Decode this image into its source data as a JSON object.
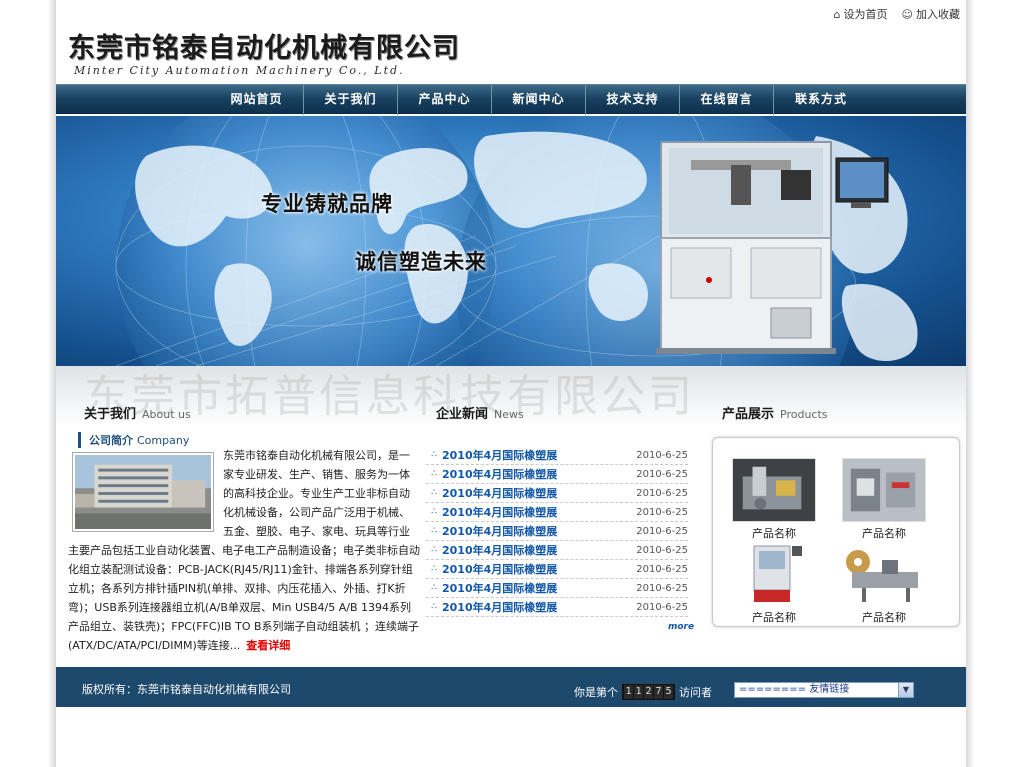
{
  "header": {
    "logo_cn": "东莞市铭泰自动化机械有限公司",
    "logo_en": "Minter City Automation Machinery Co., Ltd.",
    "set_home": "设为首页",
    "add_favorite": "加入收藏"
  },
  "nav": {
    "items": [
      "网站首页",
      "关于我们",
      "产品中心",
      "新闻中心",
      "技术支持",
      "在线留言",
      "联系方式"
    ]
  },
  "banner": {
    "line1": "专业铸就品牌",
    "line2": "诚信塑造未来",
    "watermark": "东莞市拓普信息科技有限公司"
  },
  "about": {
    "title": "关于我们",
    "title_en": "About us",
    "company_label": "公司简介",
    "company_label_en": "Company",
    "intro": "东莞市铭泰自动化机械有限公司，是一家专业研发、生产、销售、服务为一体的高科技企业。专业生产工业非标自动化机械设备，公司产品广泛用于机械、五金、塑胶、电子、家电、玩具等行业主要产品包括工业自动化装置、电子电工产品制造设备；电子类非标自动化组立装配测试设备：PCB-JACK(RJ45/RJ11)金针、排端各系列穿针组立机；各系列方排针插PIN机(单排、双排、内压花插入、外插、打K折弯)；USB系列连接器组立机(A/B单双层、Min USB4/5 A/B 1394系列产品组立、装铁壳)；FPC(FFC)IB TO B系列端子自动组装机 ；连续端子(ATX/DC/ATA/PCI/DIMM)等连接...",
    "more_label": "查看详细"
  },
  "news": {
    "title": "企业新闻",
    "title_en": "News",
    "items": [
      {
        "title": "2010年4月国际橡塑展",
        "date": "2010-6-25"
      },
      {
        "title": "2010年4月国际橡塑展",
        "date": "2010-6-25"
      },
      {
        "title": "2010年4月国际橡塑展",
        "date": "2010-6-25"
      },
      {
        "title": "2010年4月国际橡塑展",
        "date": "2010-6-25"
      },
      {
        "title": "2010年4月国际橡塑展",
        "date": "2010-6-25"
      },
      {
        "title": "2010年4月国际橡塑展",
        "date": "2010-6-25"
      },
      {
        "title": "2010年4月国际橡塑展",
        "date": "2010-6-25"
      },
      {
        "title": "2010年4月国际橡塑展",
        "date": "2010-6-25"
      },
      {
        "title": "2010年4月国际橡塑展",
        "date": "2010-6-25"
      }
    ],
    "more_label": "more"
  },
  "products": {
    "title": "产品展示",
    "title_en": "Products",
    "items": [
      {
        "name": "产品名称",
        "icon": "machine-photo"
      },
      {
        "name": "产品名称",
        "icon": "machine-photo"
      },
      {
        "name": "产品名称",
        "icon": "machine-photo"
      },
      {
        "name": "产品名称",
        "icon": "machine-photo"
      }
    ]
  },
  "footer": {
    "copyright": "版权所有：东莞市铭泰自动化机械有限公司",
    "visit_prefix": "你是第个",
    "counter_digits": [
      "1",
      "1",
      "2",
      "7",
      "5"
    ],
    "visit_suffix": "访问者",
    "links_select": "======== 友情链接 ========"
  },
  "colors": {
    "nav_bg": "#18405e",
    "footer_bg": "#1d4a6c",
    "news_link": "#1358a8",
    "more_detail": "#e00000"
  }
}
